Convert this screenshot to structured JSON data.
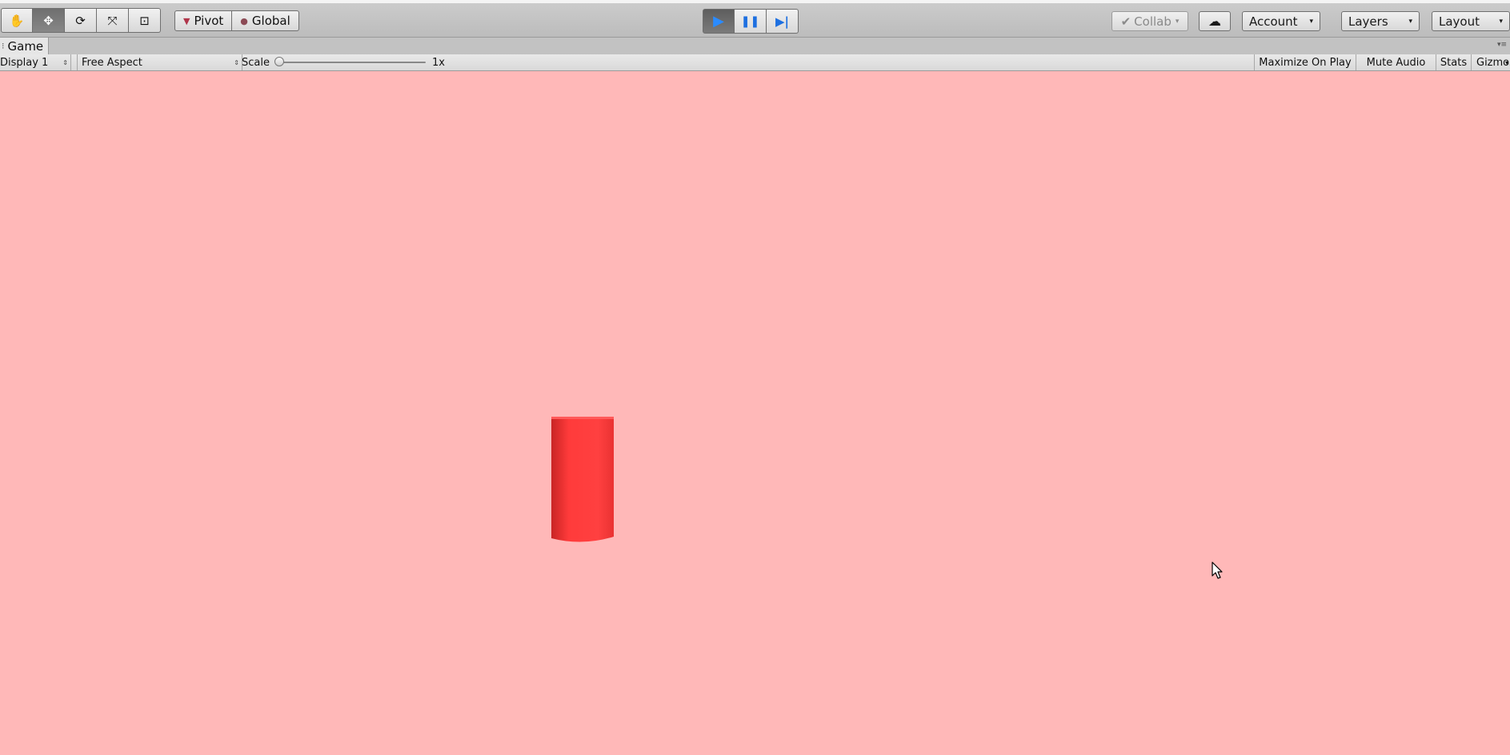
{
  "toolbar": {
    "tools": [
      {
        "name": "hand-tool",
        "glyph": "✋",
        "active": false
      },
      {
        "name": "move-tool",
        "glyph": "✥",
        "active": true
      },
      {
        "name": "rotate-tool",
        "glyph": "⟳",
        "active": false
      },
      {
        "name": "scale-tool",
        "glyph": "⤧",
        "active": false
      },
      {
        "name": "rect-tool",
        "glyph": "⊡",
        "active": false
      }
    ],
    "pivot_label": "Pivot",
    "global_label": "Global",
    "playback": {
      "play_glyph": "▶",
      "pause_glyph": "❚❚",
      "step_glyph": "▶|",
      "playing": true
    },
    "collab_label": "Collab",
    "cloud_glyph": "☁",
    "account_label": "Account",
    "layers_label": "Layers",
    "layout_label": "Layout",
    "caret": "▾"
  },
  "game_view": {
    "tab_label": "Game",
    "tab_icon": "⁝",
    "tab_menu": "▾≡",
    "display_label": "Display 1",
    "aspect_label": "Free Aspect",
    "updown": "⇕",
    "scale_label": "Scale",
    "scale_value": "1x",
    "scale_level": 0.0,
    "maximize_label": "Maximize On Play",
    "mute_label": "Mute Audio",
    "stats_label": "Stats",
    "gizmos_label": "Gizmos",
    "gizmos_caret": "▾"
  },
  "scene": {
    "background_color": "#ffb8b8",
    "cylinder_color": "#ff3b3b",
    "object": "red-cylinder"
  }
}
